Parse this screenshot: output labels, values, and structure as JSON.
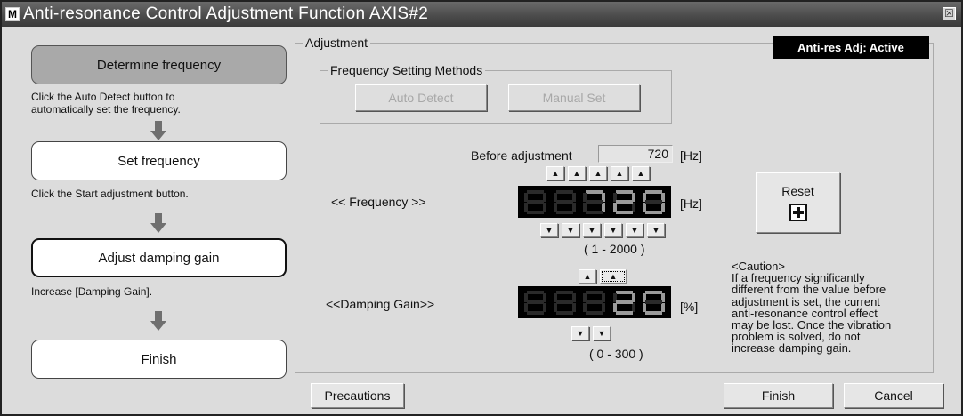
{
  "window": {
    "title": "Anti-resonance Control Adjustment Function AXIS#2",
    "app_icon": "M",
    "close_icon": "☒"
  },
  "steps": [
    {
      "label": "Determine frequency",
      "hint": "Click the Auto Detect button to\nautomatically set the frequency.",
      "state": "done"
    },
    {
      "label": "Set frequency",
      "hint": "Click the Start adjustment button.",
      "state": "pending"
    },
    {
      "label": "Adjust damping gain",
      "hint": "Increase [Damping Gain].",
      "state": "current"
    },
    {
      "label": "Finish",
      "hint": "",
      "state": "pending"
    }
  ],
  "adjustment": {
    "group_label": "Adjustment",
    "status_badge": "Anti-res Adj: Active",
    "freq_methods": {
      "group_label": "Frequency Setting Methods",
      "auto_detect": "Auto Detect",
      "manual_set": "Manual Set"
    },
    "before_label": "Before adjustment",
    "before_value": "720",
    "hz_unit": "[Hz]",
    "frequency": {
      "label": "<< Frequency >>",
      "unit": "[Hz]",
      "range": "( 1 - 2000 )",
      "display": "720"
    },
    "damping": {
      "label": "<<Damping Gain>>",
      "unit": "[%]",
      "range": "( 0 - 300 )",
      "display": "20"
    },
    "reset_label": "Reset",
    "caution": "<Caution>\nIf a frequency significantly\ndifferent from the value before\nadjustment is set, the current\nanti-resonance control effect\nmay be lost. Once the vibration\nproblem is solved, do not\nincrease damping gain."
  },
  "footer": {
    "precautions": "Precautions",
    "finish": "Finish",
    "cancel": "Cancel"
  },
  "icons": {
    "spin_up": "▲",
    "spin_down": "▼"
  },
  "colors": {
    "window_bg": "#dcdcdc",
    "titlebar": "#4a4a4a",
    "segment_on": "#9a9a9a",
    "segment_off": "#2a2a2a"
  }
}
